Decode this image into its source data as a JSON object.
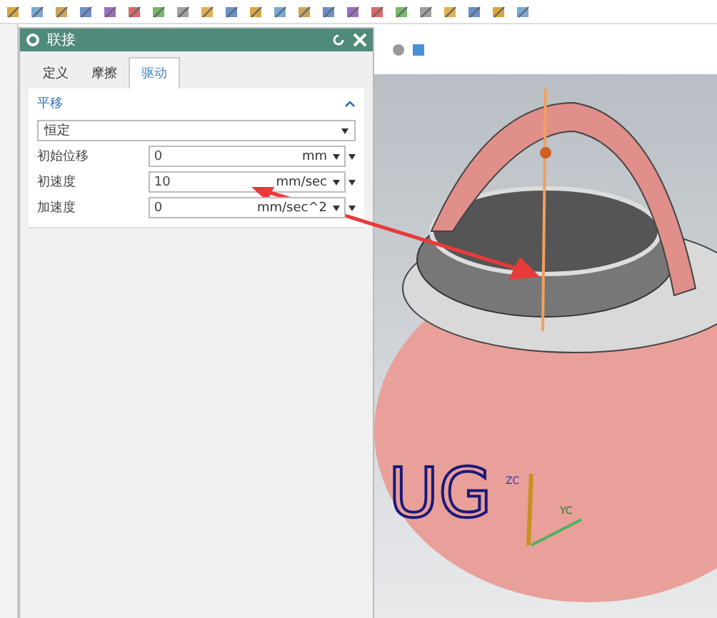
{
  "dialog": {
    "title": "联接",
    "tabs": [
      {
        "label": "定义",
        "selected": false
      },
      {
        "label": "摩擦",
        "selected": false
      },
      {
        "label": "驱动",
        "selected": true
      }
    ],
    "section": {
      "title": "平移",
      "expanded": true,
      "mode": "恒定",
      "rows": [
        {
          "label": "初始位移",
          "value": "0",
          "unit": "mm"
        },
        {
          "label": "初速度",
          "value": "10",
          "unit": "mm/sec"
        },
        {
          "label": "加速度",
          "value": "0",
          "unit": "mm/sec^2"
        }
      ]
    }
  },
  "viewport": {
    "model_text": "UG",
    "axes": [
      "ZC",
      "YC"
    ]
  }
}
